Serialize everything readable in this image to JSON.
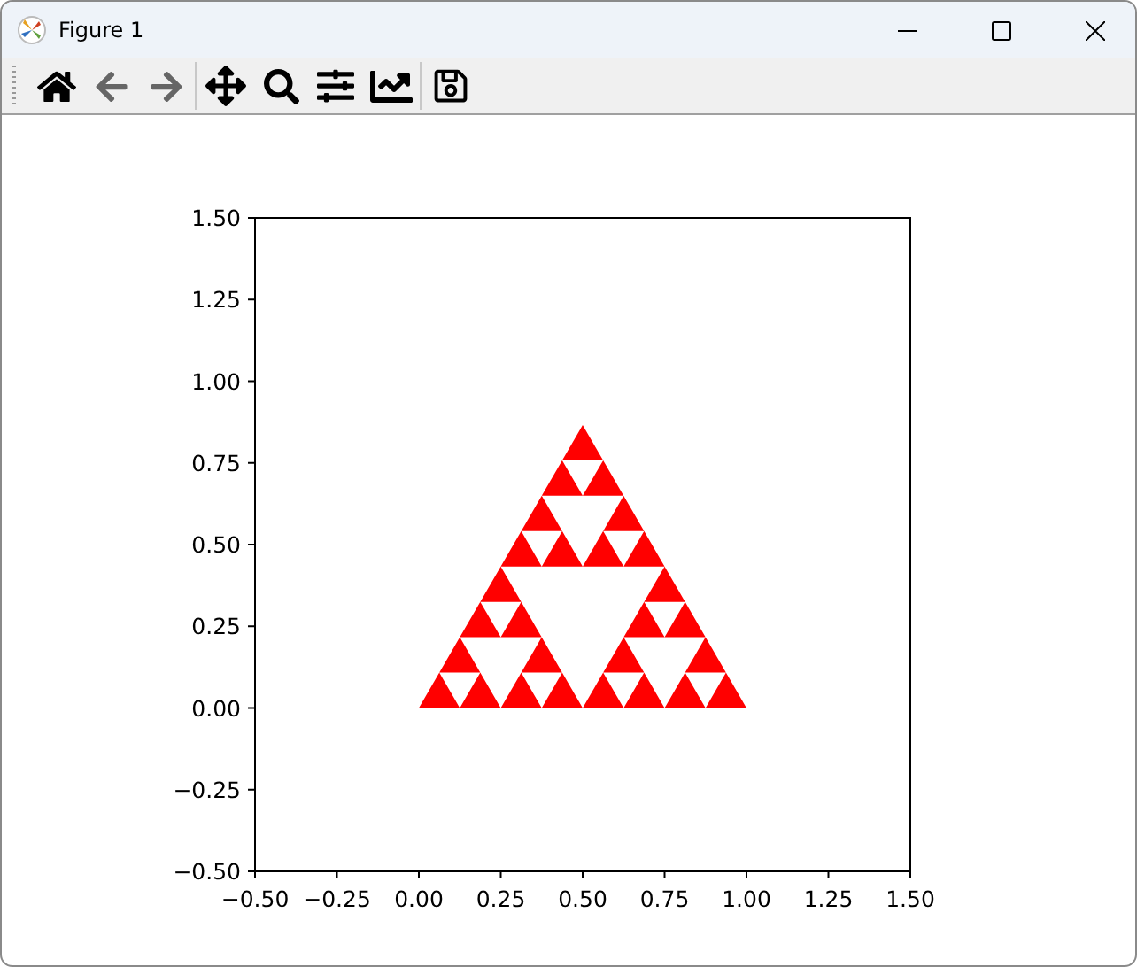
{
  "window": {
    "title": "Figure 1"
  },
  "toolbar": {
    "groups": [
      {
        "tools": [
          {
            "kind": "home",
            "disabled": false
          },
          {
            "kind": "back",
            "disabled": true
          },
          {
            "kind": "forward",
            "disabled": true
          }
        ]
      },
      {
        "tools": [
          {
            "kind": "pan",
            "disabled": false
          },
          {
            "kind": "zoom",
            "disabled": false
          },
          {
            "kind": "subplots",
            "disabled": false
          },
          {
            "kind": "axes",
            "disabled": false
          }
        ]
      },
      {
        "tools": [
          {
            "kind": "save",
            "disabled": false
          }
        ]
      }
    ]
  },
  "figure": {
    "chart_data": {
      "type": "area",
      "x": [
        0,
        0.5,
        1
      ],
      "series": [
        {
          "color": "#ff0000",
          "values": [
            0,
            0.866,
            0
          ]
        }
      ],
      "xlim": [
        -0.5,
        1.5
      ],
      "ylim": [
        -0.5,
        1.5
      ],
      "xticks": [
        {
          "value": -0.5,
          "label": "−0.50"
        },
        {
          "value": -0.25,
          "label": "−0.25"
        },
        {
          "value": 0,
          "label": "0.00"
        },
        {
          "value": 0.25,
          "label": "0.25"
        },
        {
          "value": 0.5,
          "label": "0.50"
        },
        {
          "value": 0.75,
          "label": "0.75"
        },
        {
          "value": 1,
          "label": "1.00"
        },
        {
          "value": 1.25,
          "label": "1.25"
        },
        {
          "value": 1.5,
          "label": "1.50"
        }
      ],
      "yticks": [
        {
          "value": -0.5,
          "label": "−0.50"
        },
        {
          "value": -0.25,
          "label": "−0.25"
        },
        {
          "value": 0,
          "label": "0.00"
        },
        {
          "value": 0.25,
          "label": "0.25"
        },
        {
          "value": 0.5,
          "label": "0.50"
        },
        {
          "value": 0.75,
          "label": "0.75"
        },
        {
          "value": 1,
          "label": "1.00"
        },
        {
          "value": 1.25,
          "label": "1.25"
        },
        {
          "value": 1.5,
          "label": "1.50"
        }
      ]
    }
  }
}
